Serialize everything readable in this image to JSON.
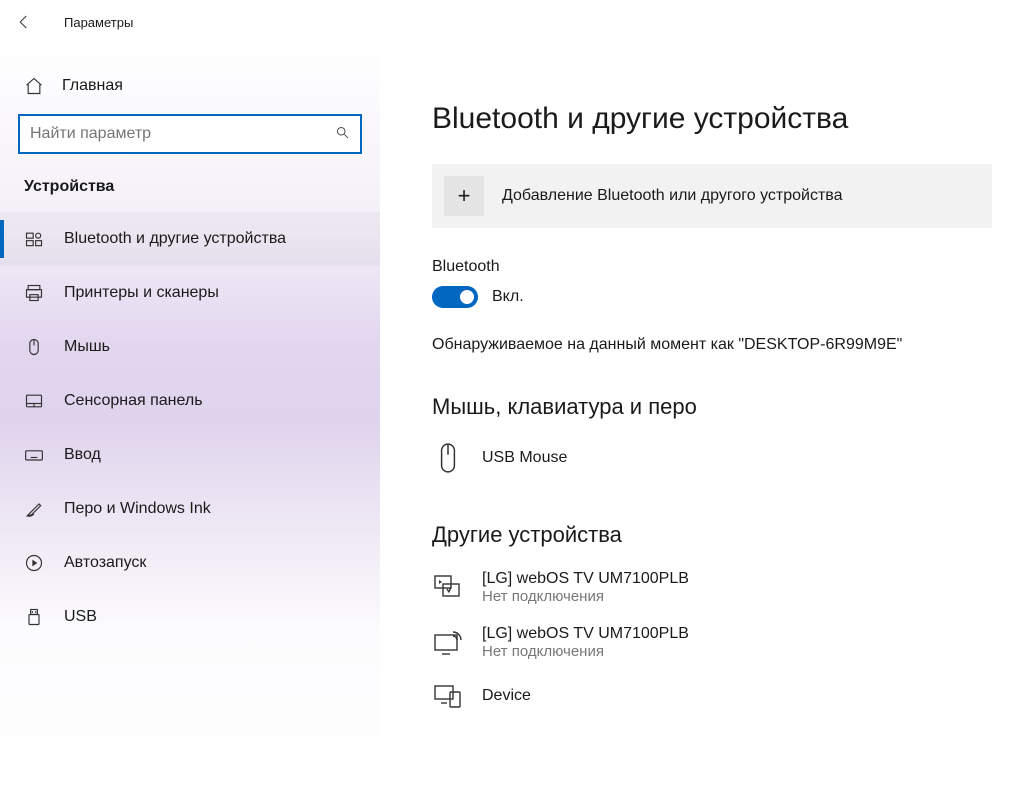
{
  "window": {
    "title": "Параметры"
  },
  "sidebar": {
    "home": "Главная",
    "search_placeholder": "Найти параметр",
    "section": "Устройства",
    "items": [
      {
        "label": "Bluetooth и другие устройства",
        "icon": "bluetooth-devices-icon",
        "active": true
      },
      {
        "label": "Принтеры и сканеры",
        "icon": "printer-icon"
      },
      {
        "label": "Мышь",
        "icon": "mouse-icon"
      },
      {
        "label": "Сенсорная панель",
        "icon": "touchpad-icon"
      },
      {
        "label": "Ввод",
        "icon": "keyboard-icon"
      },
      {
        "label": "Перо и Windows Ink",
        "icon": "pen-icon"
      },
      {
        "label": "Автозапуск",
        "icon": "autoplay-icon"
      },
      {
        "label": "USB",
        "icon": "usb-icon"
      }
    ]
  },
  "main": {
    "title": "Bluetooth и другие устройства",
    "add_device": "Добавление Bluetooth или другого устройства",
    "bt_label": "Bluetooth",
    "toggle_state": "Вкл.",
    "discoverable": "Обнаруживаемое на данный момент как \"DESKTOP-6R99M9E\"",
    "section_mouse": "Мышь, клавиатура и перо",
    "mouse_device": {
      "name": "USB Mouse"
    },
    "section_other": "Другие устройства",
    "other_devices": [
      {
        "name": "[LG] webOS TV UM7100PLB",
        "status": "Нет подключения",
        "icon": "media-device-icon"
      },
      {
        "name": "[LG] webOS TV UM7100PLB",
        "status": "Нет подключения",
        "icon": "display-wireless-icon"
      },
      {
        "name": "Device",
        "status": "",
        "icon": "generic-device-icon"
      }
    ]
  }
}
